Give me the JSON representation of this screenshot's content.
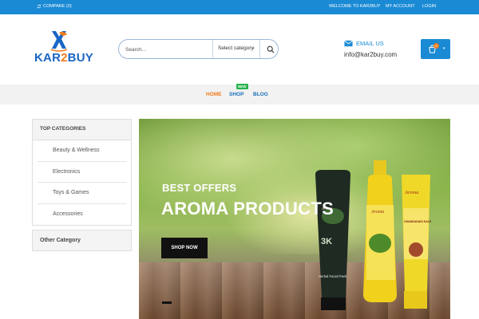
{
  "topbar": {
    "compare": "COMPARE (0)",
    "welcome": "WELCOME TO KAR2BUY",
    "my_account": "MY ACCOUNT",
    "login": "LOGIN"
  },
  "logo": {
    "text_a": "KAR",
    "text_b": "2",
    "text_c": "BUY"
  },
  "search": {
    "placeholder": "Search...",
    "category": "Select category"
  },
  "contact": {
    "email_label": "EMAIL US",
    "email": "info@kar2buy.com"
  },
  "cart": {
    "count": "0"
  },
  "nav": {
    "home": "HOME",
    "shop": "SHOP",
    "shop_badge": "NEW",
    "blog": "BLOG"
  },
  "sidebar": {
    "top_title": "TOP CATEGORIES",
    "items": [
      {
        "label": "Beauty & Wellness"
      },
      {
        "label": "Electronics"
      },
      {
        "label": "Toys & Games"
      },
      {
        "label": "Accessories"
      }
    ],
    "other_title": "Other Category"
  },
  "banner": {
    "kicker": "BEST OFFERS",
    "title": "AROMA PRODUCTS",
    "button": "SHOP NOW",
    "product_label_1": "Aroma",
    "product_label_2": "Aroma",
    "product_label_3": "Aroma",
    "product_sub_1": "Herbal Facial Pack",
    "product_sub_3": "CHANDANADI KALE"
  },
  "colors": {
    "brand_blue": "#1a8ad4",
    "accent_orange": "#f07a1a",
    "new_badge": "#27b14a"
  }
}
